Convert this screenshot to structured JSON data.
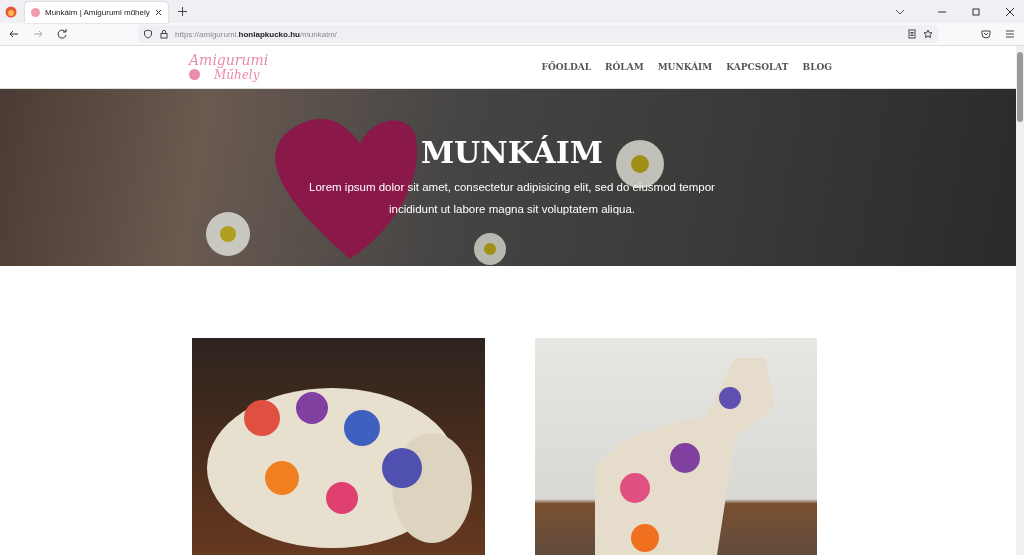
{
  "browser": {
    "tab": {
      "title": "Munkáim | Amigurumi műhely",
      "selected": true
    },
    "url": "https://amigurumi.**honlapkucko.hu**/munkaim/"
  },
  "site": {
    "logo": {
      "line_1": "Amigurumi",
      "line_2": "Műhely"
    },
    "nav": [
      {
        "label": "FŐOLDAL"
      },
      {
        "label": "RÓLAM"
      },
      {
        "label": "MUNKÁIM"
      },
      {
        "label": "KAPCSOLAT"
      },
      {
        "label": "BLOG"
      }
    ],
    "hero": {
      "title": "MUNKÁIM",
      "text": "Lorem ipsum dolor sit amet, consectetur adipisicing elit, sed do eiusmod tempor incididunt ut labore magna sit voluptatem aliqua."
    },
    "gallery": [
      {
        "kind": "hippo"
      },
      {
        "kind": "giraffe"
      }
    ]
  }
}
